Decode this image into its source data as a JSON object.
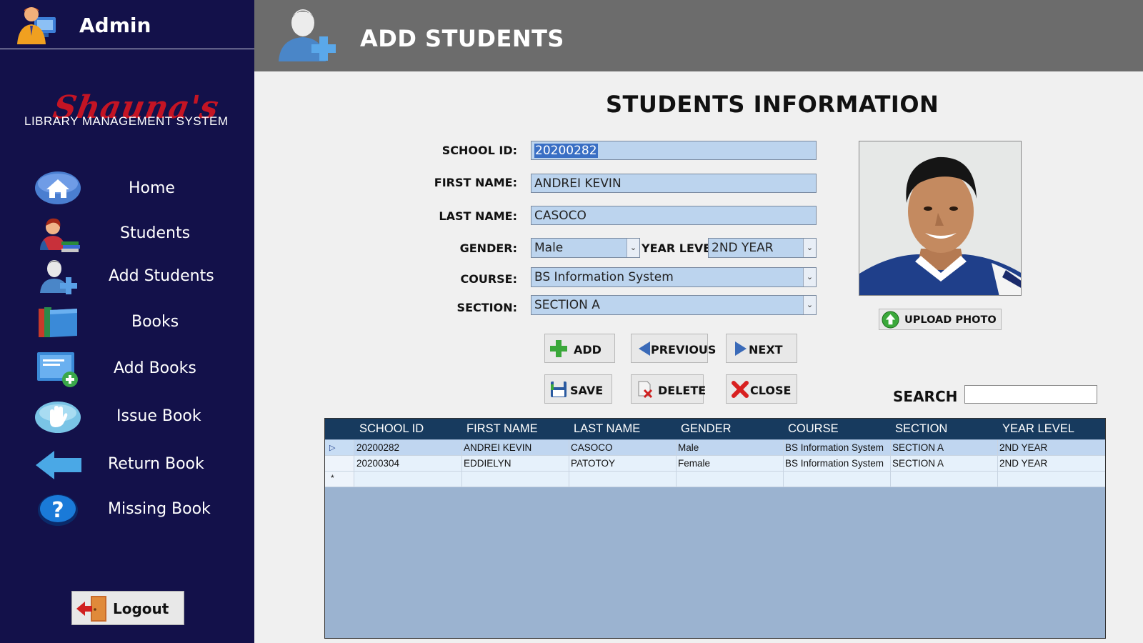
{
  "sidebar": {
    "admin_label": "Admin",
    "logo_script": "Shauna's",
    "logo_sub": "LIBRARY MANAGEMENT SYSTEM",
    "items": [
      {
        "label": "Home"
      },
      {
        "label": "Students"
      },
      {
        "label": "Add Students"
      },
      {
        "label": "Books"
      },
      {
        "label": "Add Books"
      },
      {
        "label": "Issue Book"
      },
      {
        "label": "Return Book"
      },
      {
        "label": "Missing Book"
      }
    ],
    "logout_label": "Logout"
  },
  "header": {
    "title": "ADD STUDENTS"
  },
  "form": {
    "title": "STUDENTS INFORMATION",
    "school_id_label": "SCHOOL ID:",
    "school_id_value": "20200282",
    "first_name_label": "FIRST NAME:",
    "first_name_value": "ANDREI KEVIN",
    "last_name_label": "LAST NAME:",
    "last_name_value": "CASOCO",
    "gender_label": "GENDER:",
    "gender_value": "Male",
    "year_level_label": "YEAR LEVEL:",
    "year_level_value": "2ND YEAR",
    "course_label": "COURSE:",
    "course_value": "BS Information System",
    "section_label": "SECTION:",
    "section_value": "SECTION A"
  },
  "buttons": {
    "add": "ADD",
    "previous": "PREVIOUS",
    "next": "NEXT",
    "save": "SAVE",
    "delete": "DELETE",
    "close": "CLOSE",
    "upload_photo": "UPLOAD PHOTO"
  },
  "search": {
    "label": "SEARCH",
    "value": ""
  },
  "grid": {
    "columns": [
      "SCHOOL ID",
      "FIRST NAME",
      "LAST NAME",
      "GENDER",
      "COURSE",
      "SECTION",
      "YEAR LEVEL"
    ],
    "rows": [
      [
        "20200282",
        "ANDREI KEVIN",
        "CASOCO",
        "Male",
        "BS Information System",
        "SECTION A",
        "2ND YEAR"
      ],
      [
        "20200304",
        "EDDIELYN",
        "PATOTOY",
        "Female",
        "BS Information System",
        "SECTION A",
        "2ND YEAR"
      ]
    ],
    "new_row_marker": "*"
  },
  "colors": {
    "sidebar_bg": "#13114a",
    "header_bg": "#6c6c6c",
    "input_bg": "#bcd4ee",
    "grid_header_bg": "#173a5e",
    "grid_bg": "#9bb3d0"
  }
}
